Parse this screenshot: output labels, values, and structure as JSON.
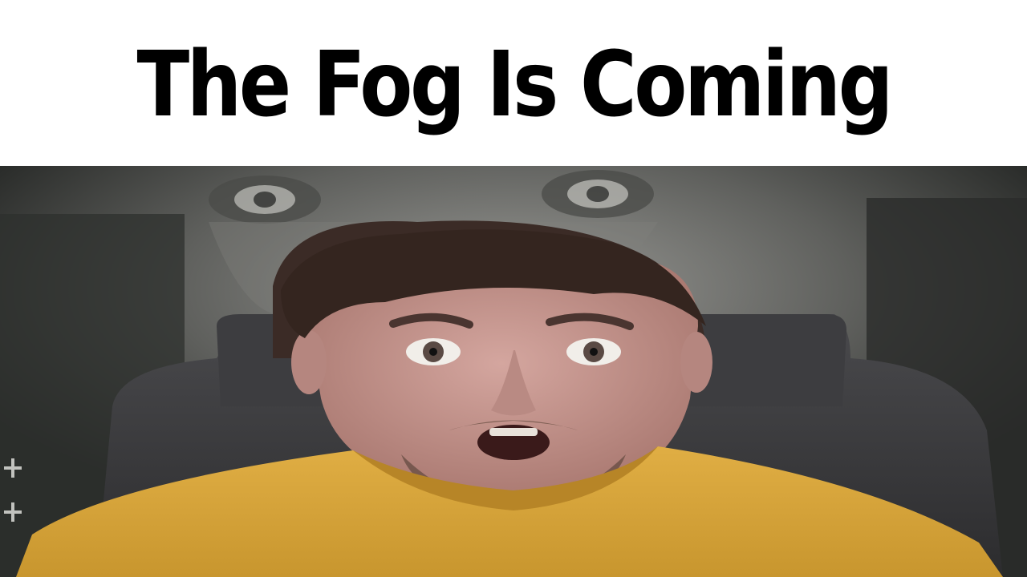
{
  "caption": {
    "text": "The Fog Is Coming"
  },
  "photo": {
    "description_icon": "surprised-person-photo",
    "colors": {
      "background_dark": "#2a2c2a",
      "fog": "#8a8a86",
      "chair": "#3a3a3c",
      "skin": "#c99b94",
      "hair": "#3b2b26",
      "shirt": "#d9a73a"
    }
  }
}
